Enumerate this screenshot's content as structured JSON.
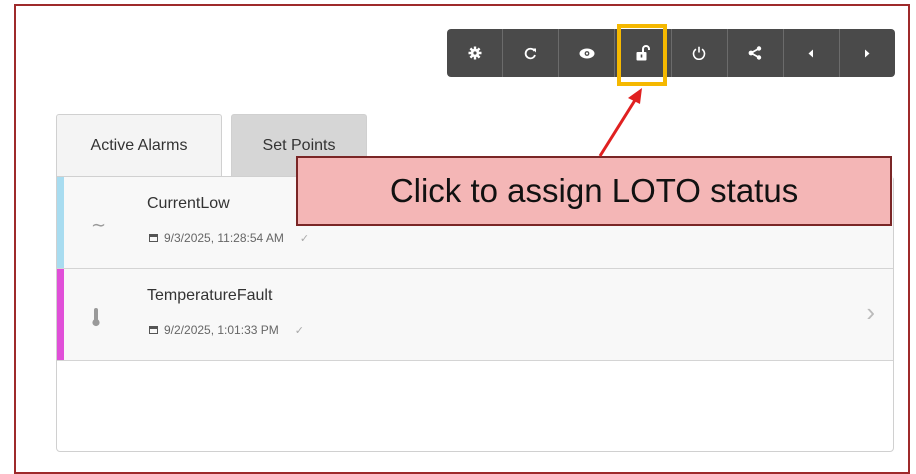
{
  "toolbar": {
    "buttons": [
      {
        "icon": "gear-icon"
      },
      {
        "icon": "refresh-icon"
      },
      {
        "icon": "eye-icon"
      },
      {
        "icon": "unlock-icon"
      },
      {
        "icon": "power-icon"
      },
      {
        "icon": "share-icon"
      },
      {
        "icon": "chevron-left-icon"
      },
      {
        "icon": "chevron-right-icon"
      }
    ]
  },
  "tabs": [
    {
      "label": "Active Alarms"
    },
    {
      "label": "Set Points"
    }
  ],
  "alarms": [
    {
      "name": "CurrentLow",
      "date": "9/3/2025, 11:28:54 AM",
      "check": "✓",
      "icon": "wave-icon",
      "stripe_color": "#a8dcf0"
    },
    {
      "name": "TemperatureFault",
      "date": "9/2/2025, 1:01:33 PM",
      "check": "✓",
      "icon": "thermometer-icon",
      "stripe_color": "#e04fd8"
    }
  ],
  "callout": {
    "text": "Click to assign LOTO status"
  },
  "colors": {
    "frame": "#9e2a2b",
    "highlight": "#f5b800",
    "callout_bg": "#f4b6b6",
    "arrow": "#e02020"
  }
}
